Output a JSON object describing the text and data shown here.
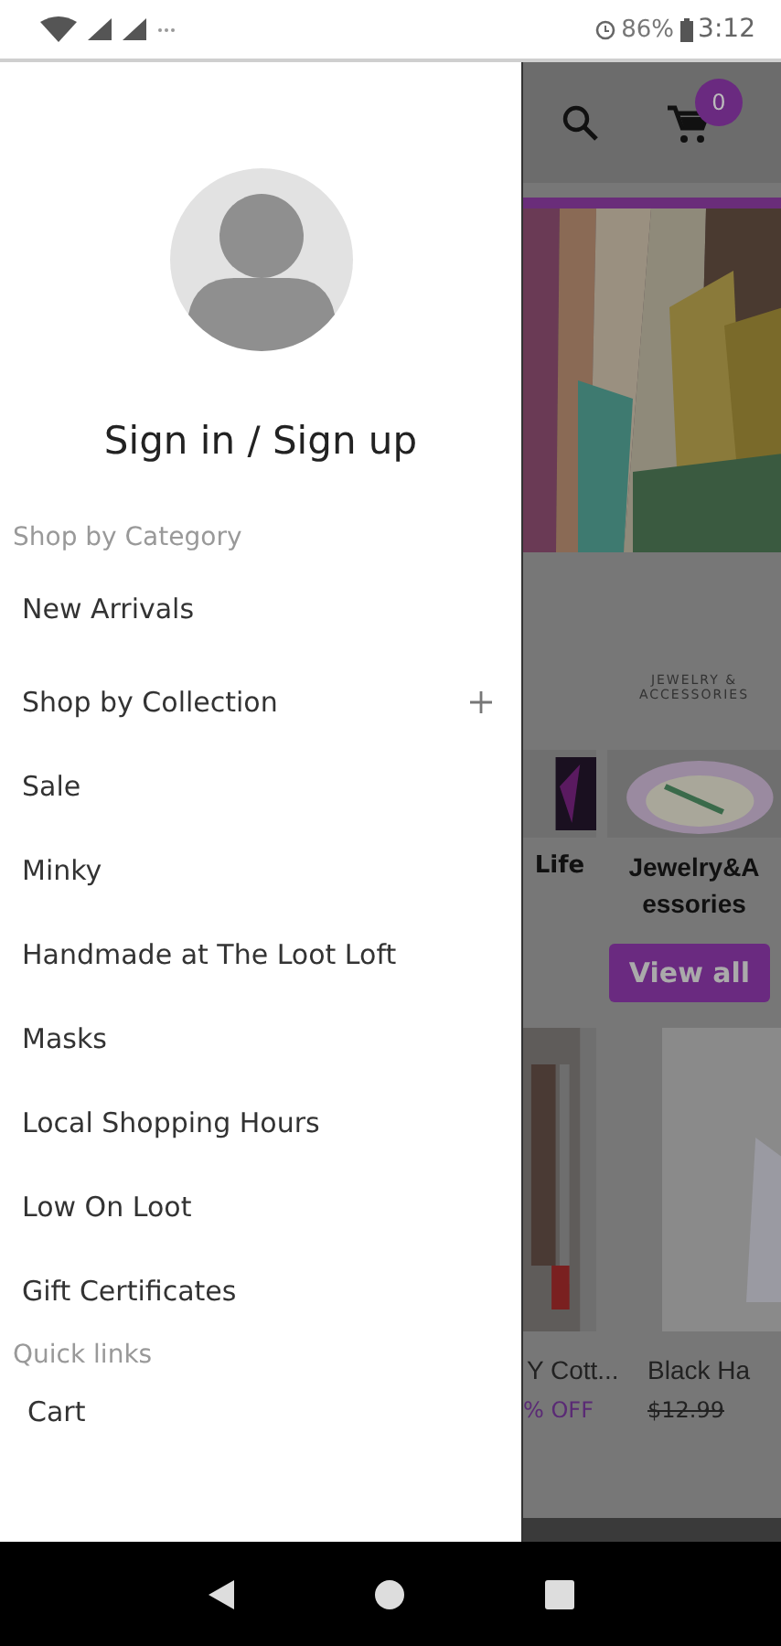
{
  "status_bar": {
    "battery": "86%",
    "time": "3:12"
  },
  "drawer": {
    "account": "Sign in / Sign up",
    "sections": [
      {
        "title": "Shop by Category",
        "items": [
          {
            "label": "New Arrivals",
            "expandable": false
          },
          {
            "label": "Shop by Collection",
            "expandable": true
          },
          {
            "label": "Sale",
            "expandable": false
          },
          {
            "label": "Minky",
            "expandable": false
          },
          {
            "label": "Handmade at The Loot Loft",
            "expandable": false
          },
          {
            "label": "Masks",
            "expandable": false
          },
          {
            "label": "Local Shopping Hours",
            "expandable": false
          },
          {
            "label": "Low On Loot",
            "expandable": false
          },
          {
            "label": "Gift Certificates",
            "expandable": false
          }
        ]
      },
      {
        "title": "Quick links",
        "items": [
          {
            "label": "Cart",
            "expandable": false
          }
        ]
      }
    ]
  },
  "background": {
    "cart_count": "0",
    "categories": [
      {
        "name": "Life"
      },
      {
        "label": "JEWELRY & ACCESSORIES",
        "name": "Jewelry&A essories"
      }
    ],
    "view_all": "View all",
    "products": [
      {
        "name": "Y Cott...",
        "price": "% OFF",
        "kind": "discount"
      },
      {
        "name": "Black Ha",
        "price": "$12.99",
        "kind": "struck"
      }
    ]
  }
}
